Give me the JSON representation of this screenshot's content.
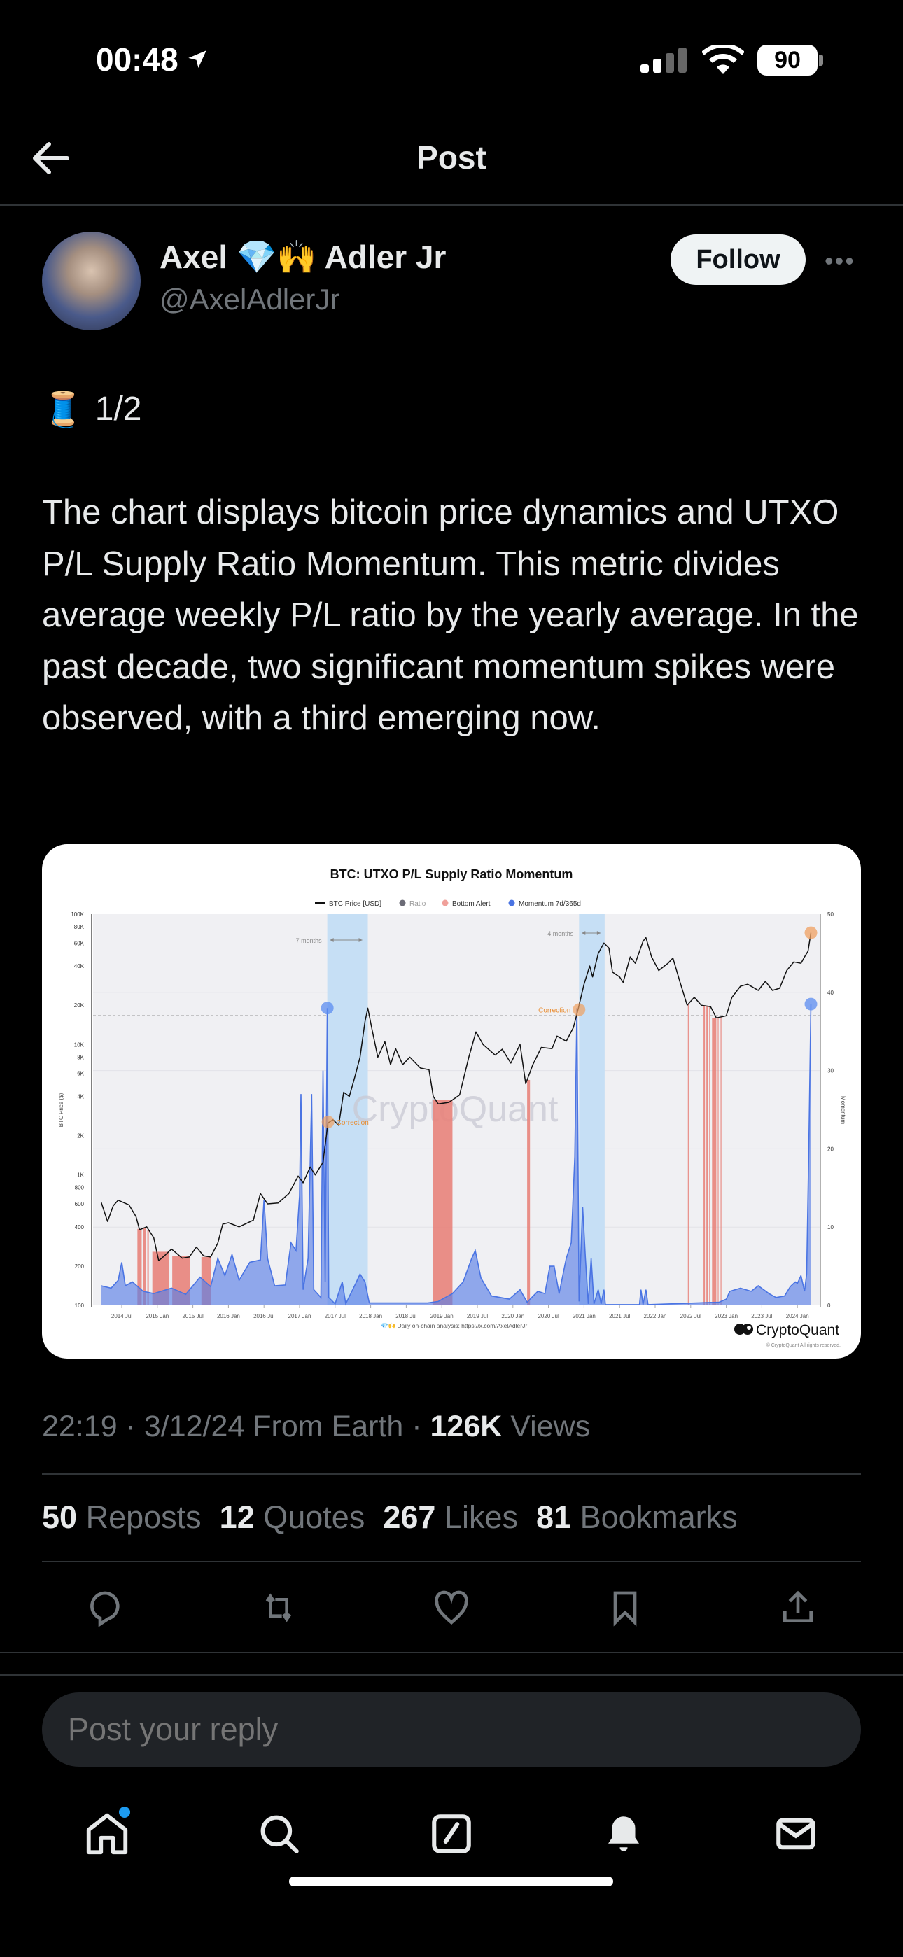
{
  "status_bar": {
    "time": "00:48",
    "battery": "90"
  },
  "header": {
    "title": "Post"
  },
  "author": {
    "name": "Axel 💎🙌 Adler Jr",
    "handle": "@AxelAdlerJr",
    "follow_label": "Follow"
  },
  "post": {
    "thread_marker": "🧵",
    "thread_index": "1/2",
    "text": "The chart displays bitcoin price dynamics and UTXO P/L Supply Ratio Momentum. This metric divides average weekly P/L ratio by the yearly average. In the past decade, two significant momentum spikes were observed, with a third emerging now."
  },
  "meta": {
    "time": "22:19",
    "date": "3/12/24",
    "source": "From Earth",
    "views_count": "126K",
    "views_label": "Views"
  },
  "stats": [
    {
      "count": "50",
      "label": "Reposts"
    },
    {
      "count": "12",
      "label": "Quotes"
    },
    {
      "count": "267",
      "label": "Likes"
    },
    {
      "count": "81",
      "label": "Bookmarks"
    }
  ],
  "actions": [
    "reply-icon",
    "repost-icon",
    "like-icon",
    "bookmark-icon",
    "share-icon"
  ],
  "reply_box": {
    "placeholder": "Post your reply"
  },
  "tabbar": [
    "home-icon",
    "search-icon",
    "compose-icon",
    "notifications-icon",
    "messages-icon"
  ],
  "colors": {
    "accent": "#1d9bf0",
    "price": "#111111",
    "momentum": "#4a74e3",
    "bottom_alert": "#e8837b",
    "highlight_band": "#c6dff5",
    "correction": "#f0a060"
  },
  "chart_data": {
    "type": "line",
    "title": "BTC: UTXO P/L Supply Ratio Momentum",
    "legend": [
      "BTC Price [USD]",
      "Ratio",
      "Bottom Alert",
      "Momentum 7d/365d"
    ],
    "legend_placement": "top",
    "ylabel": "BTC Price ($)",
    "y2label": "Momentum",
    "yscale": "log",
    "ylim": [
      100,
      100000
    ],
    "y2lim": [
      0,
      50
    ],
    "y_ticks": [
      "100K",
      "80K",
      "60K",
      "40K",
      "20K",
      "10K",
      "8K",
      "6K",
      "4K",
      "2K",
      "1K",
      "800",
      "600",
      "400",
      "200",
      "100"
    ],
    "y_tick_values": [
      100000,
      80000,
      60000,
      40000,
      20000,
      10000,
      8000,
      6000,
      4000,
      2000,
      1000,
      800,
      600,
      400,
      200,
      100
    ],
    "y2_ticks": [
      "50",
      "40",
      "30",
      "20",
      "10",
      "0"
    ],
    "x_ticks": [
      "2014 Jul",
      "2015 Jan",
      "2015 Jul",
      "2016 Jan",
      "2016 Jul",
      "2017 Jan",
      "2017 Jul",
      "2018 Jan",
      "2018 Jul",
      "2019 Jan",
      "2019 Jul",
      "2020 Jan",
      "2020 Jul",
      "2021 Jan",
      "2021 Jul",
      "2022 Jan",
      "2022 Jul",
      "2023 Jan",
      "2023 Jul",
      "2024 Jan"
    ],
    "grid": true,
    "price_series": [
      [
        2014.21,
        620
      ],
      [
        2014.3,
        440
      ],
      [
        2014.38,
        580
      ],
      [
        2014.45,
        640
      ],
      [
        2014.6,
        590
      ],
      [
        2014.7,
        480
      ],
      [
        2014.75,
        380
      ],
      [
        2014.85,
        400
      ],
      [
        2014.95,
        330
      ],
      [
        2015.02,
        220
      ],
      [
        2015.1,
        240
      ],
      [
        2015.2,
        270
      ],
      [
        2015.35,
        230
      ],
      [
        2015.45,
        235
      ],
      [
        2015.55,
        280
      ],
      [
        2015.65,
        240
      ],
      [
        2015.75,
        235
      ],
      [
        2015.85,
        300
      ],
      [
        2015.92,
        420
      ],
      [
        2016.0,
        430
      ],
      [
        2016.15,
        400
      ],
      [
        2016.35,
        450
      ],
      [
        2016.45,
        720
      ],
      [
        2016.55,
        600
      ],
      [
        2016.7,
        610
      ],
      [
        2016.85,
        720
      ],
      [
        2016.98,
        980
      ],
      [
        2017.05,
        870
      ],
      [
        2017.15,
        1150
      ],
      [
        2017.22,
        1000
      ],
      [
        2017.33,
        1250
      ],
      [
        2017.4,
        2500
      ],
      [
        2017.47,
        2650
      ],
      [
        2017.55,
        2400
      ],
      [
        2017.62,
        4300
      ],
      [
        2017.7,
        4000
      ],
      [
        2017.78,
        5700
      ],
      [
        2017.85,
        8000
      ],
      [
        2017.92,
        15000
      ],
      [
        2017.96,
        19000
      ],
      [
        2018.02,
        13000
      ],
      [
        2018.1,
        8000
      ],
      [
        2018.2,
        10500
      ],
      [
        2018.28,
        7000
      ],
      [
        2018.35,
        9300
      ],
      [
        2018.45,
        7000
      ],
      [
        2018.55,
        8000
      ],
      [
        2018.7,
        6600
      ],
      [
        2018.82,
        6400
      ],
      [
        2018.88,
        4000
      ],
      [
        2018.95,
        3500
      ],
      [
        2019.1,
        3600
      ],
      [
        2019.25,
        4100
      ],
      [
        2019.38,
        8000
      ],
      [
        2019.48,
        12500
      ],
      [
        2019.58,
        10000
      ],
      [
        2019.75,
        8300
      ],
      [
        2019.85,
        9200
      ],
      [
        2019.97,
        7200
      ],
      [
        2020.1,
        10000
      ],
      [
        2020.18,
        5000
      ],
      [
        2020.28,
        7000
      ],
      [
        2020.4,
        9500
      ],
      [
        2020.55,
        9300
      ],
      [
        2020.62,
        11600
      ],
      [
        2020.75,
        10600
      ],
      [
        2020.85,
        13500
      ],
      [
        2020.92,
        19000
      ],
      [
        2021.0,
        29000
      ],
      [
        2021.08,
        40000
      ],
      [
        2021.12,
        33000
      ],
      [
        2021.2,
        50000
      ],
      [
        2021.28,
        60000
      ],
      [
        2021.35,
        55000
      ],
      [
        2021.4,
        36000
      ],
      [
        2021.5,
        33000
      ],
      [
        2021.55,
        30000
      ],
      [
        2021.65,
        47000
      ],
      [
        2021.72,
        42000
      ],
      [
        2021.83,
        62000
      ],
      [
        2021.87,
        66000
      ],
      [
        2021.95,
        47000
      ],
      [
        2022.05,
        37000
      ],
      [
        2022.18,
        42000
      ],
      [
        2022.25,
        46000
      ],
      [
        2022.35,
        30000
      ],
      [
        2022.45,
        20000
      ],
      [
        2022.55,
        23000
      ],
      [
        2022.65,
        20000
      ],
      [
        2022.78,
        19500
      ],
      [
        2022.86,
        16000
      ],
      [
        2023.0,
        16600
      ],
      [
        2023.08,
        23000
      ],
      [
        2023.2,
        28000
      ],
      [
        2023.3,
        29000
      ],
      [
        2023.45,
        26000
      ],
      [
        2023.55,
        30500
      ],
      [
        2023.65,
        26000
      ],
      [
        2023.75,
        27000
      ],
      [
        2023.85,
        37000
      ],
      [
        2023.95,
        43000
      ],
      [
        2024.05,
        42000
      ],
      [
        2024.1,
        47000
      ],
      [
        2024.15,
        52000
      ],
      [
        2024.19,
        72000
      ]
    ],
    "momentum_series": [
      [
        2014.21,
        2.5
      ],
      [
        2014.35,
        2.2
      ],
      [
        2014.45,
        3.2
      ],
      [
        2014.5,
        5.5
      ],
      [
        2014.55,
        2.5
      ],
      [
        2014.65,
        3
      ],
      [
        2014.8,
        1.8
      ],
      [
        2014.95,
        1.5
      ],
      [
        2015.2,
        2.2
      ],
      [
        2015.4,
        1.4
      ],
      [
        2015.6,
        3.6
      ],
      [
        2015.75,
        2.4
      ],
      [
        2015.85,
        6
      ],
      [
        2015.95,
        3.8
      ],
      [
        2016.05,
        6.5
      ],
      [
        2016.15,
        3.2
      ],
      [
        2016.3,
        5.5
      ],
      [
        2016.45,
        5.8
      ],
      [
        2016.5,
        13.5
      ],
      [
        2016.55,
        6
      ],
      [
        2016.65,
        2.5
      ],
      [
        2016.8,
        2.6
      ],
      [
        2016.88,
        8
      ],
      [
        2016.95,
        7
      ],
      [
        2017.0,
        14
      ],
      [
        2017.02,
        27
      ],
      [
        2017.05,
        2
      ],
      [
        2017.12,
        6
      ],
      [
        2017.17,
        27
      ],
      [
        2017.2,
        2
      ],
      [
        2017.3,
        1
      ],
      [
        2017.33,
        30
      ],
      [
        2017.36,
        3
      ],
      [
        2017.39,
        38
      ],
      [
        2017.41,
        1
      ],
      [
        2017.5,
        0.2
      ],
      [
        2017.6,
        3
      ],
      [
        2017.65,
        0.2
      ],
      [
        2017.8,
        3
      ],
      [
        2017.85,
        4
      ],
      [
        2017.92,
        3
      ],
      [
        2017.98,
        0.3
      ],
      [
        2018.8,
        0.3
      ],
      [
        2018.95,
        0.5
      ],
      [
        2019.15,
        1.5
      ],
      [
        2019.3,
        3
      ],
      [
        2019.42,
        6
      ],
      [
        2019.47,
        7
      ],
      [
        2019.55,
        3.5
      ],
      [
        2019.7,
        1.2
      ],
      [
        2019.95,
        0.8
      ],
      [
        2020.1,
        2
      ],
      [
        2020.2,
        0.4
      ],
      [
        2020.35,
        1.8
      ],
      [
        2020.45,
        1.5
      ],
      [
        2020.52,
        5
      ],
      [
        2020.58,
        5
      ],
      [
        2020.65,
        1.5
      ],
      [
        2020.75,
        6
      ],
      [
        2020.82,
        8
      ],
      [
        2020.87,
        19
      ],
      [
        2020.9,
        38
      ],
      [
        2020.93,
        0.5
      ],
      [
        2020.98,
        12.6
      ],
      [
        2021.02,
        6
      ],
      [
        2021.06,
        0.2
      ],
      [
        2021.1,
        6
      ],
      [
        2021.14,
        0.2
      ],
      [
        2021.2,
        2
      ],
      [
        2021.24,
        0.2
      ],
      [
        2021.28,
        2
      ],
      [
        2021.3,
        0.1
      ],
      [
        2021.78,
        0.1
      ],
      [
        2021.8,
        2
      ],
      [
        2021.83,
        0.1
      ],
      [
        2021.87,
        2
      ],
      [
        2021.9,
        0.1
      ],
      [
        2022.9,
        0.4
      ],
      [
        2023.0,
        0.8
      ],
      [
        2023.05,
        1.8
      ],
      [
        2023.2,
        2.2
      ],
      [
        2023.35,
        1.8
      ],
      [
        2023.45,
        2.5
      ],
      [
        2023.6,
        1.5
      ],
      [
        2023.7,
        1
      ],
      [
        2023.82,
        1.2
      ],
      [
        2023.9,
        2.4
      ],
      [
        2023.97,
        3
      ],
      [
        2024.0,
        2.8
      ],
      [
        2024.05,
        3.8
      ],
      [
        2024.1,
        1.8
      ],
      [
        2024.13,
        4
      ],
      [
        2024.16,
        20
      ],
      [
        2024.19,
        38.5
      ]
    ],
    "bottom_alert_ranges": [
      [
        2014.72,
        2014.78
      ],
      [
        2014.8,
        2014.84
      ],
      [
        2014.86,
        2014.88
      ],
      [
        2014.93,
        2015.16
      ],
      [
        2015.21,
        2015.46
      ],
      [
        2015.62,
        2015.75
      ],
      [
        2018.87,
        2019.15
      ],
      [
        2020.2,
        2020.24
      ],
      [
        2022.46,
        2022.47
      ],
      [
        2022.68,
        2022.7
      ],
      [
        2022.72,
        2022.74
      ],
      [
        2022.76,
        2022.77
      ],
      [
        2022.8,
        2022.86
      ],
      [
        2022.88,
        2022.89
      ],
      [
        2022.92,
        2022.93
      ]
    ],
    "highlight_bands": [
      {
        "from": 2017.39,
        "to": 2017.96,
        "label": "7 months"
      },
      {
        "from": 2020.93,
        "to": 2021.29,
        "label": "4 months"
      }
    ],
    "annotations": [
      {
        "label": "Correction",
        "date": 2017.4,
        "price": 2550
      },
      {
        "label": "Correction",
        "date": 2020.93,
        "price": 18500
      }
    ],
    "momentum_markers": [
      {
        "date": 2017.39,
        "value": 38
      },
      {
        "date": 2024.19,
        "value": 38.5
      }
    ],
    "price_marker": {
      "date": 2024.19,
      "price": 72000
    },
    "threshold_price": 16700,
    "watermark": "CryptoQuant",
    "footer": "💎🙌 Daily on-chain analysis: https://x.com/AxelAdlerJr",
    "brand": "CryptoQuant",
    "copyright": "© CryptoQuant All rights reserved."
  }
}
